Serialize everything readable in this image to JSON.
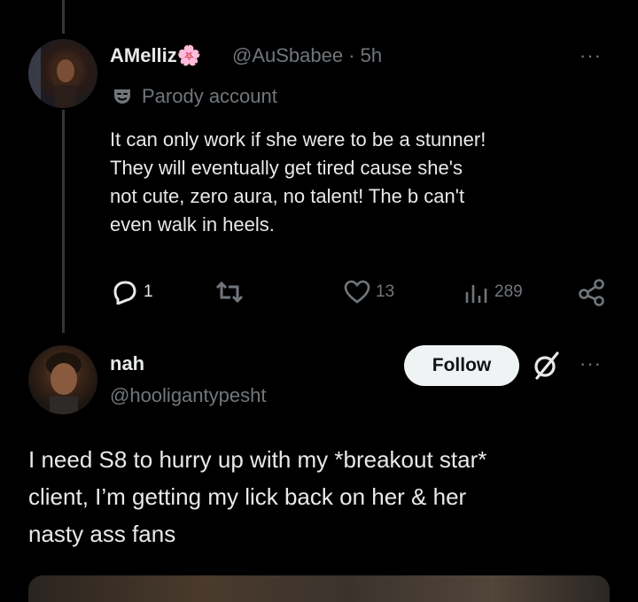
{
  "tweet1": {
    "display_name": "AMelliz",
    "name_emoji": "🌸",
    "handle": "@AuSbabee",
    "separator": "·",
    "time": "5h",
    "badge_label": "Parody account",
    "text": "It can only work if she were to be a stunner!\nThey will eventually get tired cause she's\nnot cute, zero aura, no talent! The b can't\neven walk in heels.",
    "actions": {
      "reply_count": "1",
      "retweet_count": "",
      "like_count": "13",
      "view_count": "289"
    },
    "more_label": "···"
  },
  "tweet2": {
    "display_name": "nah",
    "handle": "@hooligantypesht",
    "follow_label": "Follow",
    "more_label": "···",
    "text": "I need S8 to hurry up with my *breakout star*\nclient, I’m getting my lick back on her & her\nnasty ass fans"
  },
  "colors": {
    "background": "#000000",
    "text": "#e7e9ea",
    "muted": "#71767b",
    "follow_bg": "#eff3f4"
  },
  "icons": [
    "more-icon",
    "parody-mask-icon",
    "reply-icon",
    "retweet-icon",
    "like-icon",
    "views-icon",
    "share-icon",
    "grok-icon"
  ]
}
